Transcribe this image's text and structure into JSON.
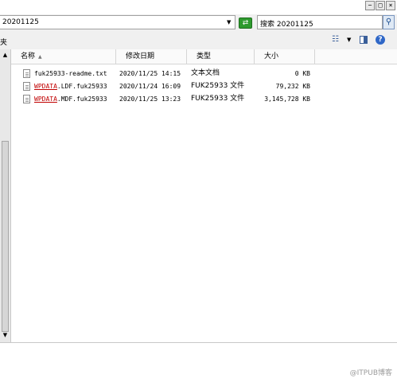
{
  "window": {
    "minimize": "−",
    "maximize": "□",
    "close": "×"
  },
  "address": {
    "path": "20201125"
  },
  "search": {
    "value": "搜索 20201125"
  },
  "toolbar": {
    "left_label": "夹"
  },
  "columns": {
    "name": "名称",
    "modified": "修改日期",
    "type": "类型",
    "size": "大小"
  },
  "files": [
    {
      "name_pre": "",
      "name_red": "",
      "name_post": "fuk25933-readme.txt",
      "modified": "2020/11/25 14:15",
      "type": "文本文档",
      "size": "0 KB"
    },
    {
      "name_pre": "",
      "name_red": "WPDATA",
      "name_post": ".LDF.fuk25933",
      "modified": "2020/11/24 16:09",
      "type": "FUK25933 文件",
      "size": "79,232 KB"
    },
    {
      "name_pre": "",
      "name_red": "WPDATA",
      "name_post": ".MDF.fuk25933",
      "modified": "2020/11/25 13:23",
      "type": "FUK25933 文件",
      "size": "3,145,728 KB"
    }
  ],
  "watermark": "@ITPUB博客",
  "colors": {
    "go_button": "#2e9a2e",
    "redacted": "#c00000",
    "help": "#2f67c7"
  },
  "icons": {
    "go": "go-arrow-icon",
    "search": "magnifier-icon",
    "views": "views-icon",
    "help": "help-icon"
  }
}
